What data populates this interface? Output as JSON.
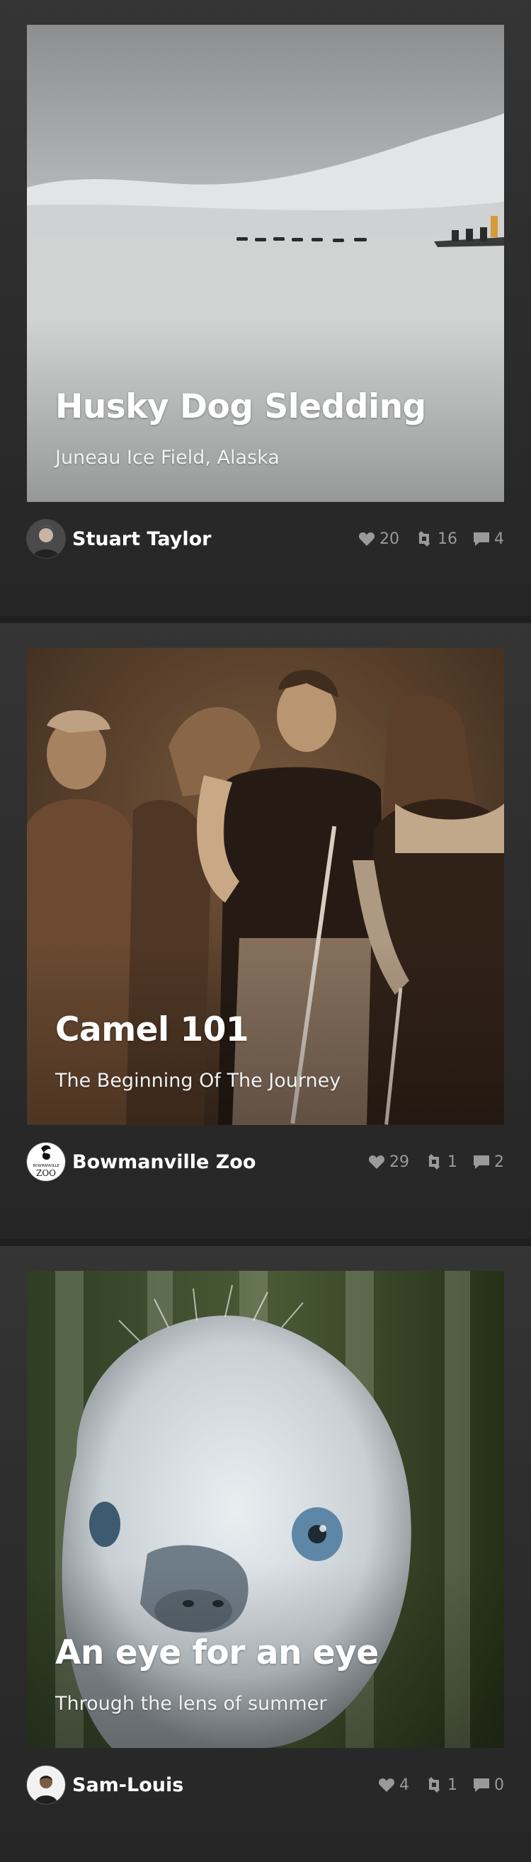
{
  "feed": {
    "cards": [
      {
        "title": "Husky Dog Sledding",
        "subtitle": "Juneau Ice Field, Alaska",
        "author": "Stuart Taylor",
        "likes": "20",
        "reposts": "16",
        "comments": "4"
      },
      {
        "title": "Camel 101",
        "subtitle": "The Beginning Of The Journey",
        "author": "Bowmanville Zoo",
        "avatar_text_top": "BOWMANVILLE",
        "avatar_text_bottom": "ZOO",
        "likes": "29",
        "reposts": "1",
        "comments": "2"
      },
      {
        "title": "An eye for an eye",
        "subtitle": "Through the lens of summer",
        "author": "Sam-Louis",
        "likes": "4",
        "reposts": "1",
        "comments": "0"
      }
    ]
  },
  "icons": {
    "like": "heart-icon",
    "repost": "repost-icon",
    "comment": "comment-icon"
  },
  "colors": {
    "background": "#2b2b2b",
    "text": "#ffffff",
    "muted": "#9a9a9a"
  }
}
